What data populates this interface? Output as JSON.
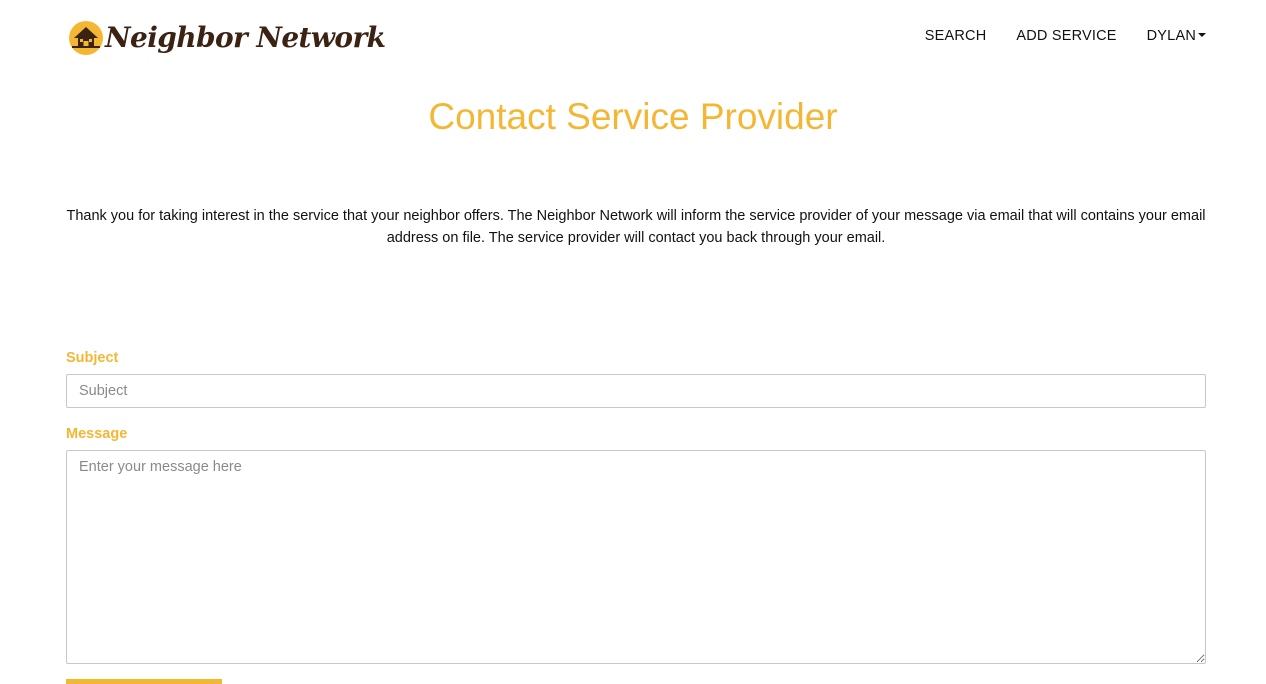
{
  "header": {
    "brand": {
      "name": "Neighbor Network",
      "logo_icon": "house-icon"
    },
    "nav": [
      {
        "label": "SEARCH"
      },
      {
        "label": "ADD SERVICE"
      },
      {
        "label": "DYLAN",
        "icon": "caret-down-icon"
      }
    ]
  },
  "main": {
    "title": "Contact Service Provider",
    "intro": "Thank you for taking interest in the service that your neighbor offers. The Neighbor Network will inform the service provider of your message via email that will contains your email address on file. The service provider will contact you back through your email.",
    "form": {
      "subject": {
        "label": "Subject",
        "value": "",
        "placeholder": "Subject"
      },
      "message": {
        "label": "Message",
        "value": "",
        "placeholder": "Enter your message here"
      }
    }
  },
  "colors": {
    "accent": "#f4b734",
    "brand_text": "#3b2314",
    "text": "#111111",
    "input_border": "#c8c8c8"
  }
}
